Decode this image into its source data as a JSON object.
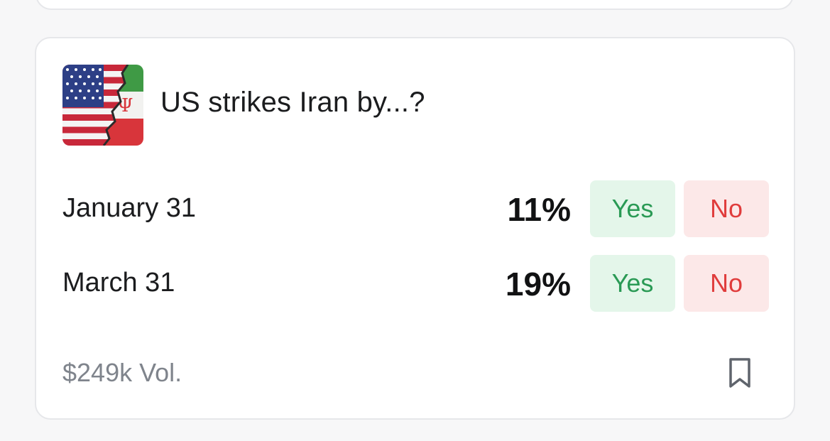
{
  "market": {
    "title": "US strikes Iran by...?",
    "thumbnail_icon": "us-iran-flags-image",
    "outcomes": [
      {
        "label": "January 31",
        "percent": "11%",
        "yes_label": "Yes",
        "no_label": "No"
      },
      {
        "label": "March 31",
        "percent": "19%",
        "yes_label": "Yes",
        "no_label": "No"
      }
    ],
    "volume": "$249k Vol.",
    "bookmark_icon": "bookmark-icon"
  },
  "colors": {
    "yes_bg": "#e4f6ea",
    "yes_text": "#2a9a55",
    "no_bg": "#fce8e8",
    "no_text": "#e03c3c",
    "muted_text": "#7f848c"
  }
}
